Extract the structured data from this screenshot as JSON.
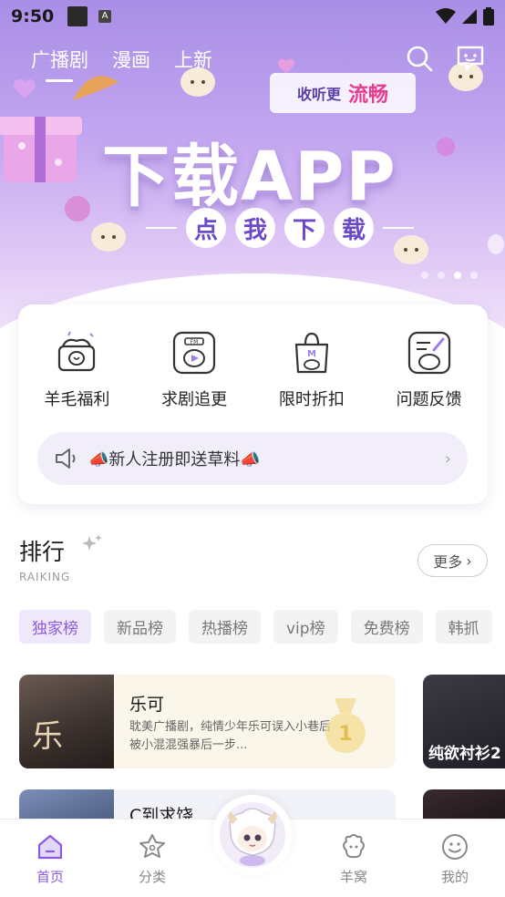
{
  "status_bar": {
    "time": "9:50",
    "notif_letter": "A"
  },
  "nav": {
    "tabs": [
      {
        "label": "广播剧",
        "active": true
      },
      {
        "label": "漫画",
        "active": false
      },
      {
        "label": "上新",
        "active": false
      }
    ],
    "icons": [
      "search-icon",
      "message-icon"
    ]
  },
  "banner": {
    "pill_prefix": "收听更",
    "pill_highlight": "流畅",
    "title": "下载APP",
    "cta_chars": [
      "点",
      "我",
      "下",
      "载"
    ],
    "page_count": 4,
    "active_page": 3
  },
  "quick_actions": [
    {
      "label": "羊毛福利",
      "icon": "gift-box-icon"
    },
    {
      "label": "求剧追更",
      "icon": "fm-radio-icon"
    },
    {
      "label": "限时折扣",
      "icon": "shopping-bag-icon"
    },
    {
      "label": "问题反馈",
      "icon": "feedback-note-icon"
    }
  ],
  "notice": {
    "text": "📣新人注册即送草料📣",
    "icon": "speaker-icon"
  },
  "ranking": {
    "title": "排行",
    "subtitle": "RAIKING",
    "more_label": "更多",
    "chips": [
      {
        "label": "独家榜",
        "active": true
      },
      {
        "label": "新品榜",
        "active": false
      },
      {
        "label": "热播榜",
        "active": false
      },
      {
        "label": "vip榜",
        "active": false
      },
      {
        "label": "免费榜",
        "active": false
      },
      {
        "label": "韩抓",
        "active": false
      }
    ],
    "featured": {
      "cover_char": "乐",
      "title": "乐可",
      "desc": "耽美广播剧，纯情少年乐可误入小巷后被小混混强暴后一步..."
    },
    "side_item": {
      "title": "纯欲衬衫2"
    },
    "second": {
      "title": "C到求饶"
    }
  },
  "bottom_nav": [
    {
      "label": "首页",
      "active": true,
      "icon": "home-icon"
    },
    {
      "label": "分类",
      "active": false,
      "icon": "category-star-icon"
    },
    {
      "label": "羊窝",
      "active": false,
      "icon": "sheep-den-icon"
    },
    {
      "label": "我的",
      "active": false,
      "icon": "profile-smile-icon"
    }
  ],
  "colors": {
    "accent": "#8a5ae0",
    "banner_top": "#a98ee6",
    "chip_active_bg": "#efe8fb"
  }
}
